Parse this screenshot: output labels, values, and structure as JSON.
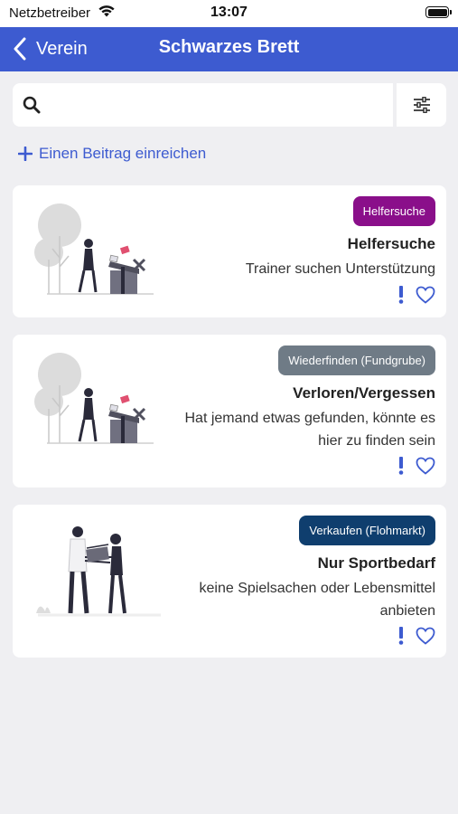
{
  "status_bar": {
    "carrier": "Netzbetreiber",
    "time": "13:07"
  },
  "nav": {
    "back_label": "Verein",
    "title": "Schwarzes Brett"
  },
  "search": {
    "value": "",
    "placeholder": ""
  },
  "add_post_label": "Einen Beitrag einreichen",
  "colors": {
    "primary": "#3d5bd0",
    "badge_helfersuche": "#8a0f8a",
    "badge_wiederfinden": "#6f7b86",
    "badge_verkaufen": "#0f3e6e"
  },
  "posts": [
    {
      "category": "Helfersuche",
      "title": "Helfersuche",
      "description": "Trainer suchen Unterstützung",
      "illustration": "gift-box-illustration"
    },
    {
      "category": "Wiederfinden (Fundgrube)",
      "title": "Verloren/Vergessen",
      "description": "Hat jemand etwas gefunden, könnte es hier zu finden sein",
      "illustration": "gift-box-illustration"
    },
    {
      "category": "Verkaufen (Flohmarkt)",
      "title": "Nur Sportbedarf",
      "description": "keine Spielsachen oder Lebensmittel anbieten",
      "illustration": "handover-illustration"
    }
  ]
}
